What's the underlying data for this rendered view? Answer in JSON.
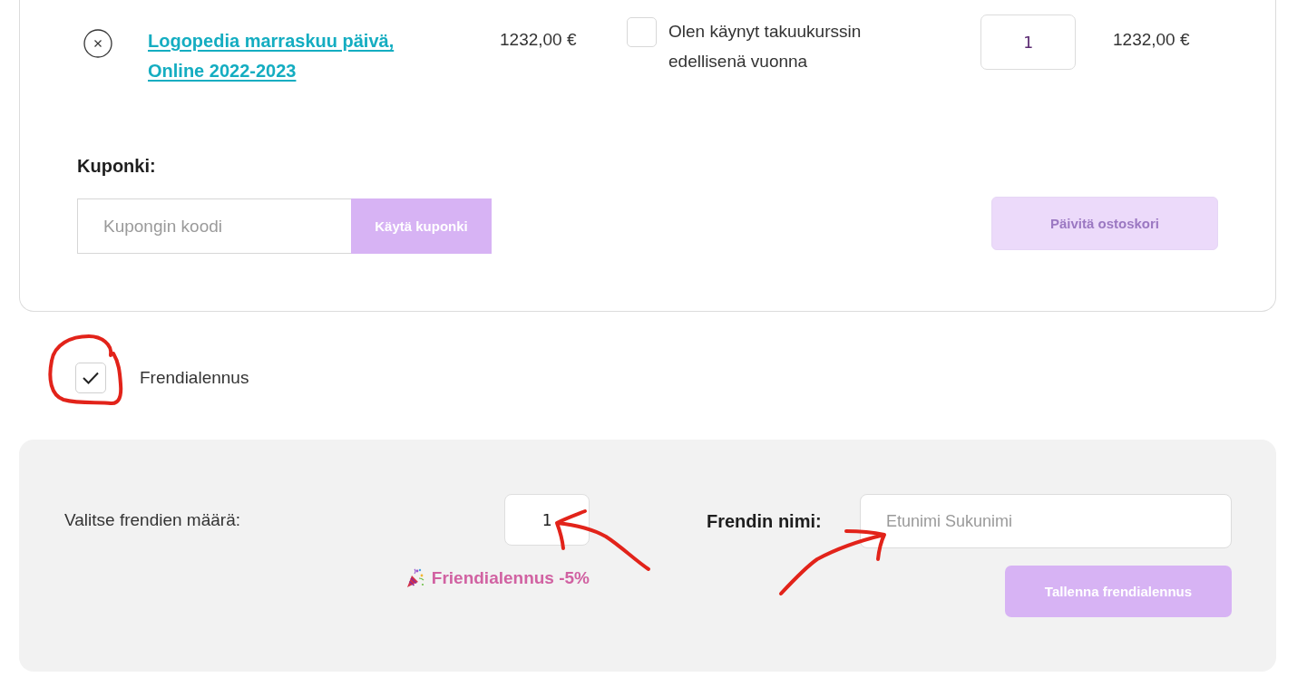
{
  "cart": {
    "items": [
      {
        "title": "Logopedia marraskuu päivä, Online 2022-2023",
        "price": "1232,00 €",
        "guarantee_label": "Olen käynyt takuukurssin edellisenä vuonna",
        "guarantee_checked": false,
        "quantity": "1",
        "subtotal": "1232,00 €"
      }
    ],
    "coupon": {
      "label": "Kuponki:",
      "placeholder": "Kupongin koodi",
      "button": "Käytä kuponki"
    },
    "update_button": {
      "label": "Päivitä ostoskori",
      "disabled": true
    }
  },
  "friend_discount": {
    "label": "Frendialennus",
    "checked": true
  },
  "friend_form": {
    "count_label": "Valitse frendien määrä:",
    "count": "1",
    "discount": "Friendialennus -5%",
    "name_label": "Frendin nimi:",
    "name_placeholder": "Etunimi Sukunimi",
    "save_button": "Tallenna frendialennus"
  }
}
